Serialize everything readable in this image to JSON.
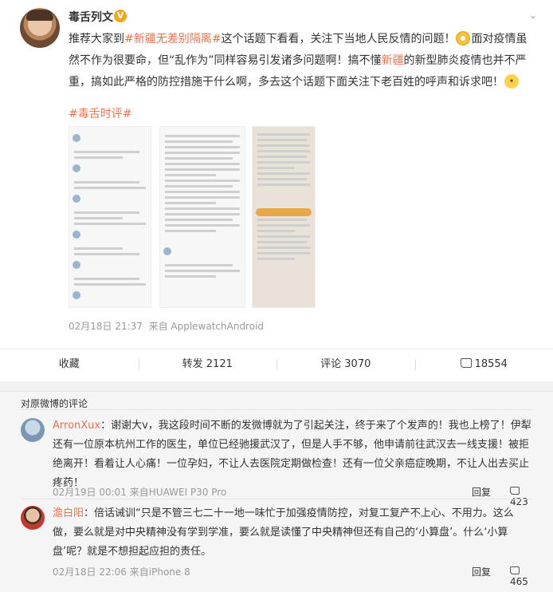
{
  "post": {
    "username": "毒舌列文",
    "verified_badge": "V",
    "text_parts": {
      "p1": "推荐大家到",
      "link": "#新疆无差别隔离#",
      "p2": "这个话题下看看，关注下当地人民反情的问题！",
      "p3": "面对疫情虽然不作为很要命，但“乱作为”同样容易引发诸多问题啊！搞不懂",
      "xj": "新疆",
      "p4": "的新型肺炎疫情也并不严重，搞如此严格的防控措施干什么啊，多去这个话题下面关注下老百姓的呼声和诉求吧！"
    },
    "hashtag": "#毒舌时评#",
    "timestamp": "02月18日 21:37",
    "source": "来自 ApplewatchAndroid",
    "actions": {
      "favorite": "收藏",
      "repost": "转发 2121",
      "comment": "评论 3070",
      "like": "18554"
    }
  },
  "comments_section": {
    "title": "对原微博的评论",
    "items": [
      {
        "name": "ArronXux",
        "text": "：谢谢大v，我这段时间不断的发微博就为了引起关注，终于来了个发声的！我也上榜了！伊犁还有一位原本杭州工作的医生，单位已经驰援武汉了，但是人手不够，他申请前往武汉去一线支援！被拒绝离开！看着让人心痛！一位孕妇，不让人去医院定期做检查！还有一位父亲癌症晚期，不让人出去买止疼药！",
        "time": "02月19日 00:01",
        "source": "来自HUAWEI P30 Pro",
        "reply": "回复",
        "likes": "423"
      },
      {
        "name": "澹白阳",
        "text": "：倍话诫训“只是不管三七二十一地一味忙于加强疫情防控，对复工复产不上心、不用力。这么做，要么就是对中央精神没有学到学准，要么就是读懂了中央精神但还有自己的‘小算盘’。什么‘小算盘’呢？就是不想担起应担的责任。",
        "time": "02月18日 22:06",
        "source": "来自iPhone 8",
        "reply": "回复",
        "likes": "465"
      }
    ]
  },
  "colors": {
    "accent": "#eb7350",
    "verified": "#f7a614"
  }
}
